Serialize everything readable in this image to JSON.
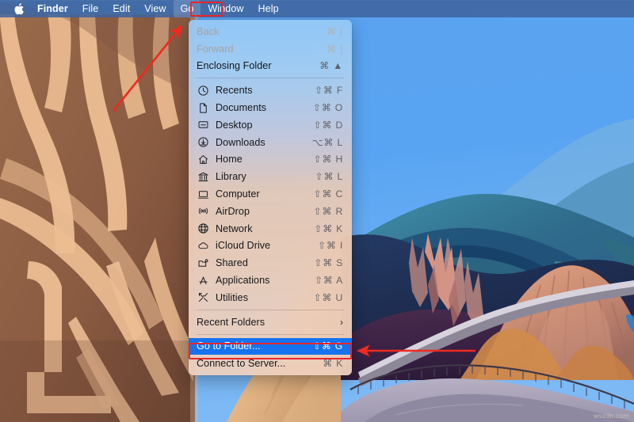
{
  "menubar": {
    "apple_icon": "apple-logo-icon",
    "items": [
      {
        "label": "Finder",
        "bold": true,
        "active": false
      },
      {
        "label": "File",
        "bold": false,
        "active": false
      },
      {
        "label": "Edit",
        "bold": false,
        "active": false
      },
      {
        "label": "View",
        "bold": false,
        "active": false
      },
      {
        "label": "Go",
        "bold": false,
        "active": true
      },
      {
        "label": "Window",
        "bold": false,
        "active": false
      },
      {
        "label": "Help",
        "bold": false,
        "active": false
      }
    ],
    "highlighted_item": "Go",
    "highlight_color": "#e8262b",
    "background_color": "#3c5f96"
  },
  "go_menu": {
    "selected_item": "Go to Folder...",
    "selection_color": "#1573f0",
    "highlight_color": "#e8262b",
    "groups": [
      {
        "items": [
          {
            "label": "Back",
            "shortcut": "⌘ [",
            "icon": "",
            "disabled": true,
            "selected": false,
            "submenu": false
          },
          {
            "label": "Forward",
            "shortcut": "⌘ ]",
            "icon": "",
            "disabled": true,
            "selected": false,
            "submenu": false
          },
          {
            "label": "Enclosing Folder",
            "shortcut": "⌘ ▲",
            "icon": "",
            "disabled": false,
            "selected": false,
            "submenu": false
          }
        ]
      },
      {
        "items": [
          {
            "label": "Recents",
            "shortcut": "⇧⌘ F",
            "icon": "clock-icon",
            "disabled": false,
            "selected": false,
            "submenu": false
          },
          {
            "label": "Documents",
            "shortcut": "⇧⌘ O",
            "icon": "document-icon",
            "disabled": false,
            "selected": false,
            "submenu": false
          },
          {
            "label": "Desktop",
            "shortcut": "⇧⌘ D",
            "icon": "desktop-icon",
            "disabled": false,
            "selected": false,
            "submenu": false
          },
          {
            "label": "Downloads",
            "shortcut": "⌥⌘ L",
            "icon": "download-icon",
            "disabled": false,
            "selected": false,
            "submenu": false
          },
          {
            "label": "Home",
            "shortcut": "⇧⌘ H",
            "icon": "home-icon",
            "disabled": false,
            "selected": false,
            "submenu": false
          },
          {
            "label": "Library",
            "shortcut": "⇧⌘ L",
            "icon": "library-icon",
            "disabled": false,
            "selected": false,
            "submenu": false
          },
          {
            "label": "Computer",
            "shortcut": "⇧⌘ C",
            "icon": "computer-icon",
            "disabled": false,
            "selected": false,
            "submenu": false
          },
          {
            "label": "AirDrop",
            "shortcut": "⇧⌘ R",
            "icon": "airdrop-icon",
            "disabled": false,
            "selected": false,
            "submenu": false
          },
          {
            "label": "Network",
            "shortcut": "⇧⌘ K",
            "icon": "network-icon",
            "disabled": false,
            "selected": false,
            "submenu": false
          },
          {
            "label": "iCloud Drive",
            "shortcut": "⇧⌘ I",
            "icon": "cloud-icon",
            "disabled": false,
            "selected": false,
            "submenu": false
          },
          {
            "label": "Shared",
            "shortcut": "⇧⌘ S",
            "icon": "shared-folder-icon",
            "disabled": false,
            "selected": false,
            "submenu": false
          },
          {
            "label": "Applications",
            "shortcut": "⇧⌘ A",
            "icon": "appstore-icon",
            "disabled": false,
            "selected": false,
            "submenu": false
          },
          {
            "label": "Utilities",
            "shortcut": "⇧⌘ U",
            "icon": "utilities-icon",
            "disabled": false,
            "selected": false,
            "submenu": false
          }
        ]
      },
      {
        "items": [
          {
            "label": "Recent Folders",
            "shortcut": "",
            "icon": "",
            "disabled": false,
            "selected": false,
            "submenu": true
          }
        ]
      },
      {
        "items": [
          {
            "label": "Go to Folder...",
            "shortcut": "⇧⌘ G",
            "icon": "",
            "disabled": false,
            "selected": true,
            "submenu": false
          },
          {
            "label": "Connect to Server...",
            "shortcut": "⌘ K",
            "icon": "",
            "disabled": false,
            "selected": false,
            "submenu": false
          }
        ]
      }
    ]
  },
  "annotations": {
    "arrow_color": "#ee2a20",
    "arrows": [
      {
        "name": "arrow-to-go-menu",
        "direction": "up-right"
      },
      {
        "name": "arrow-to-go-to-folder",
        "direction": "left"
      }
    ]
  },
  "watermark": {
    "text": "wsxdn.com"
  },
  "wallpaper": {
    "name": "macos-big-sur-canyon-wallpaper"
  }
}
